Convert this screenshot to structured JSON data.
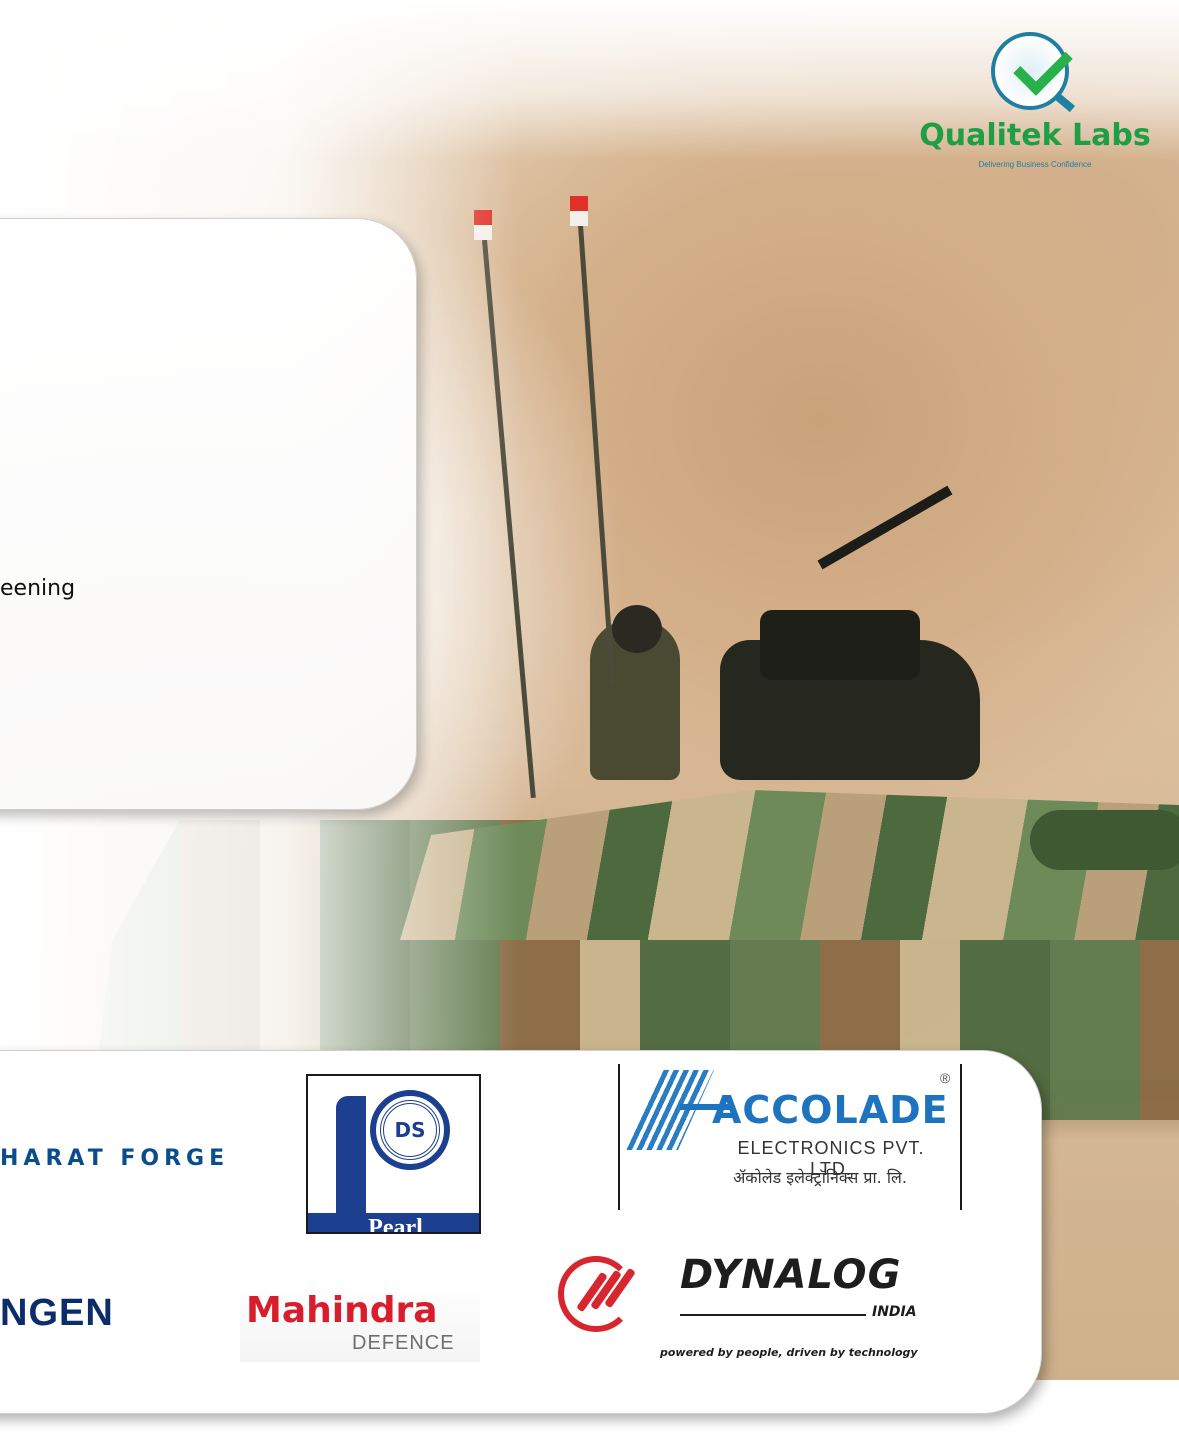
{
  "panel_text": "eening",
  "brand": {
    "name": "Qualitek Labs",
    "tagline": "Delivering Business Confidence",
    "colors": {
      "green": "#1e9e45",
      "blue": "#1f7fa0"
    }
  },
  "partners": {
    "bharat_forge": "HARAT FORGE",
    "ngen": "NGEN",
    "pearl": {
      "monogram": "DS",
      "banner": "Pearl"
    },
    "accolade": {
      "name": "ACCOLADE",
      "registered": "®",
      "subtitle": "ELECTRONICS PVT. LTD.",
      "hindi": "ॲकोलेड इलेक्ट्रॉनिक्स प्रा. लि."
    },
    "mahindra": {
      "name": "Mahindra",
      "sub": "DEFENCE"
    },
    "dynalog": {
      "name": "DYNALOG",
      "region": "INDIA",
      "tagline": "powered by people, driven by technology"
    }
  }
}
